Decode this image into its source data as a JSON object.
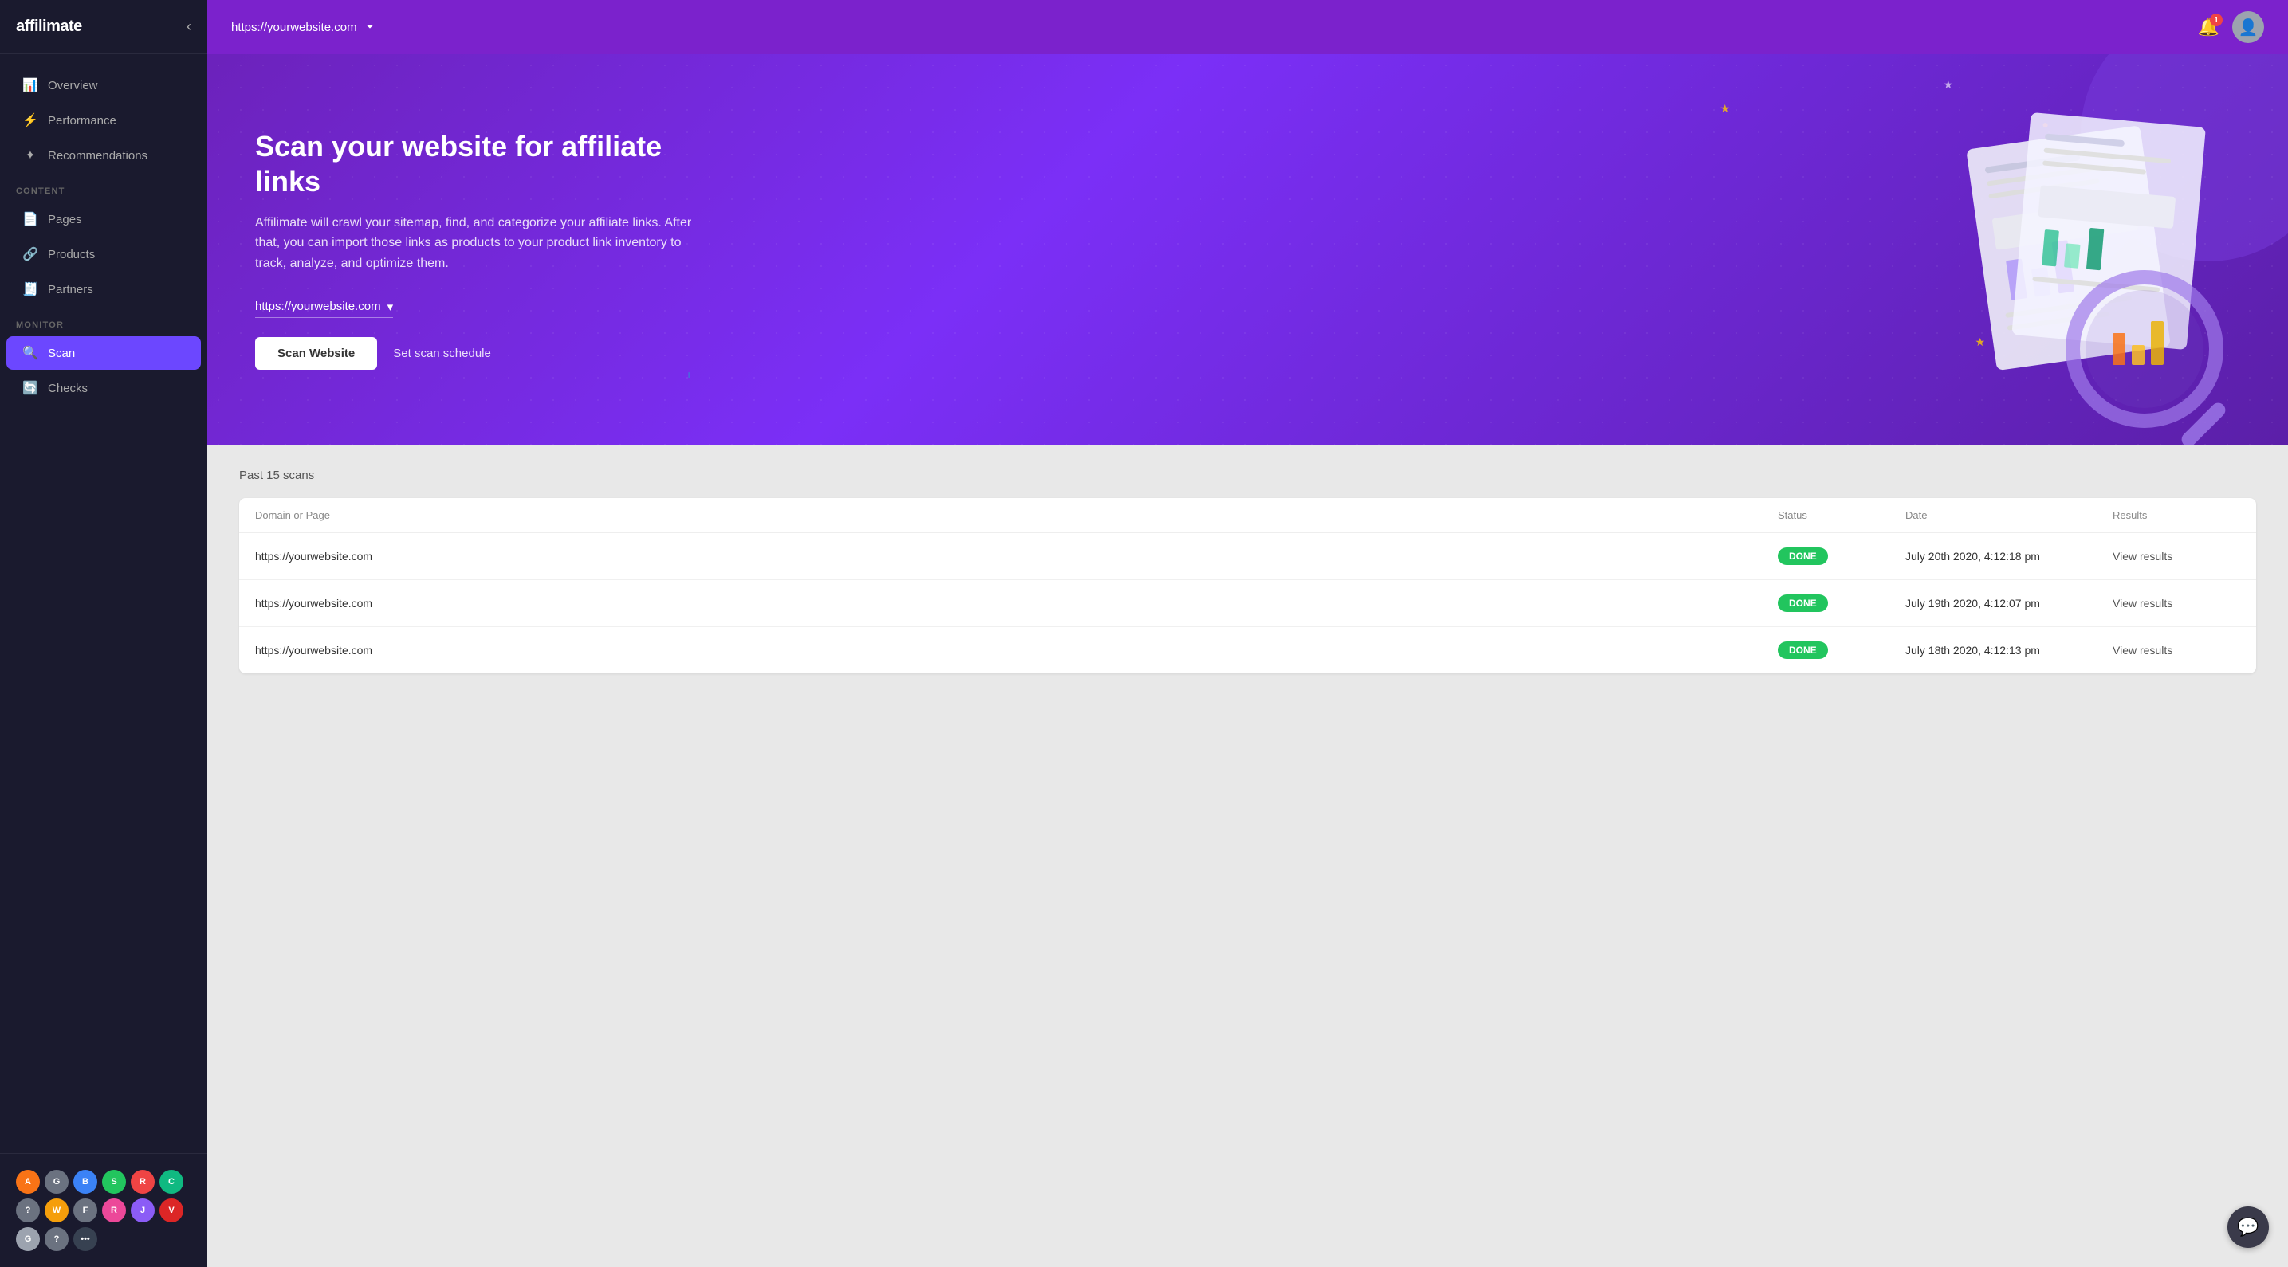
{
  "logo": {
    "text": "affilimate"
  },
  "header": {
    "url_selector": "https://yourwebsite.com",
    "chevron": "▾",
    "notification_count": "1"
  },
  "sidebar": {
    "nav_items": [
      {
        "id": "overview",
        "label": "Overview",
        "icon": "📊"
      },
      {
        "id": "performance",
        "label": "Performance",
        "icon": "⚡"
      },
      {
        "id": "recommendations",
        "label": "Recommendations",
        "icon": "☀"
      }
    ],
    "content_label": "CONTENT",
    "content_items": [
      {
        "id": "pages",
        "label": "Pages",
        "icon": "📄"
      },
      {
        "id": "products",
        "label": "Products",
        "icon": "🔗"
      },
      {
        "id": "partners",
        "label": "Partners",
        "icon": "🧾"
      }
    ],
    "monitor_label": "MONITOR",
    "monitor_items": [
      {
        "id": "scan",
        "label": "Scan",
        "icon": "🔍",
        "active": true
      },
      {
        "id": "checks",
        "label": "Checks",
        "icon": "🔄"
      }
    ]
  },
  "hero": {
    "title": "Scan your website for affiliate links",
    "description": "Affilimate will crawl your sitemap, find, and categorize your affiliate links. After that, you can import those links as products to your product link inventory to track, analyze, and optimize them.",
    "url_selector": "https://yourwebsite.com",
    "scan_button": "Scan Website",
    "schedule_link": "Set scan schedule"
  },
  "scans": {
    "title": "Past 15 scans",
    "columns": {
      "domain": "Domain or Page",
      "status": "Status",
      "date": "Date",
      "results": "Results"
    },
    "rows": [
      {
        "domain": "https://yourwebsite.com",
        "status": "DONE",
        "date": "July 20th 2020, 4:12:18 pm",
        "results": "View results"
      },
      {
        "domain": "https://yourwebsite.com",
        "status": "DONE",
        "date": "July 19th 2020, 4:12:07 pm",
        "results": "View results"
      },
      {
        "domain": "https://yourwebsite.com",
        "status": "DONE",
        "date": "July 18th 2020, 4:12:13 pm",
        "results": "View results"
      }
    ]
  },
  "partner_icons": [
    {
      "label": "A",
      "color": "#f97316"
    },
    {
      "label": "G",
      "color": "#6b7280"
    },
    {
      "label": "B",
      "color": "#3b82f6"
    },
    {
      "label": "S",
      "color": "#22c55e"
    },
    {
      "label": "R",
      "color": "#ef4444"
    },
    {
      "label": "C",
      "color": "#10b981"
    },
    {
      "label": "?",
      "color": "#6b7280"
    },
    {
      "label": "W",
      "color": "#f59e0b"
    },
    {
      "label": "F",
      "color": "#6b7280"
    },
    {
      "label": "R",
      "color": "#ec4899"
    },
    {
      "label": "J",
      "color": "#8b5cf6"
    },
    {
      "label": "V",
      "color": "#dc2626"
    },
    {
      "label": "G",
      "color": "#9ca3af"
    },
    {
      "label": "?",
      "color": "#6b7280"
    },
    {
      "label": "•••",
      "color": "#374151"
    }
  ],
  "chat_button": "💬"
}
